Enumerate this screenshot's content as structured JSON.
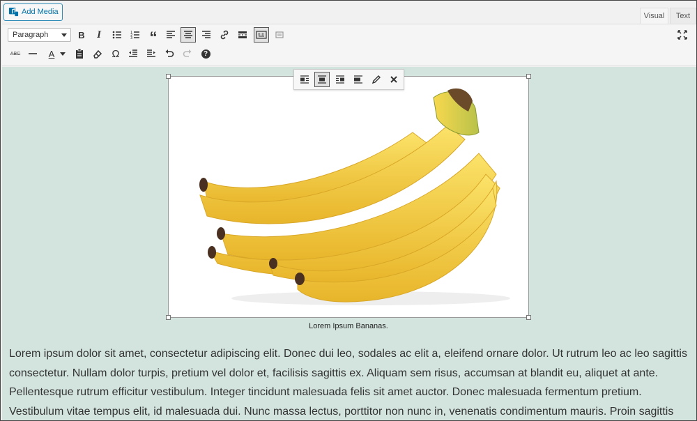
{
  "add_media": {
    "label": "Add Media",
    "icon": "media-icon"
  },
  "tabs": {
    "visual": "Visual",
    "text": "Text"
  },
  "toolbar": {
    "format_select": "Paragraph",
    "row1": [
      "bold-icon",
      "italic-icon",
      "bullet-list-icon",
      "numbered-list-icon",
      "blockquote-icon",
      "align-left-icon",
      "align-center-icon",
      "align-right-icon",
      "link-icon",
      "read-more-icon",
      "toolbar-toggle-icon",
      "distraction-free-icon",
      "fullscreen-icon"
    ],
    "row2": [
      "strikethrough-icon",
      "horizontal-line-icon",
      "text-color-icon",
      "paste-as-text-icon",
      "clear-formatting-icon",
      "special-character-icon",
      "outdent-icon",
      "indent-icon",
      "undo-icon",
      "redo-icon",
      "help-icon"
    ],
    "bold_glyph": "B",
    "italic_glyph": "I",
    "quote_glyph": "“",
    "text_color_glyph": "A",
    "omega_glyph": "Ω",
    "help_glyph": "?",
    "strike_glyph": "ABC"
  },
  "image_toolbar": [
    "align-left-icon",
    "align-center-icon",
    "align-right-icon",
    "align-none-icon",
    "edit-icon",
    "remove-icon"
  ],
  "image": {
    "subject": "bananas",
    "caption": "Lorem Ipsum Bananas."
  },
  "body_text": "Lorem ipsum dolor sit amet, consectetur adipiscing elit. Donec dui leo, sodales ac elit a, eleifend ornare dolor. Ut rutrum leo ac leo sagittis consectetur. Nullam dolor turpis, pretium vel dolor et, facilisis sagittis ex. Aliquam sem risus, accumsan at blandit eu, aliquet at ante. Pellentesque rutrum efficitur vestibulum. Integer tincidunt malesuada felis sit amet auctor. Donec malesuada fermentum pretium. Vestibulum vitae tempus elit, id malesuada dui. Nunc massa lectus, porttitor non nunc in, venenatis condimentum mauris. Proin sagittis",
  "colors": {
    "accent": "#0073aa",
    "content_bg": "#d3e4df",
    "banana": "#f5d54a"
  }
}
